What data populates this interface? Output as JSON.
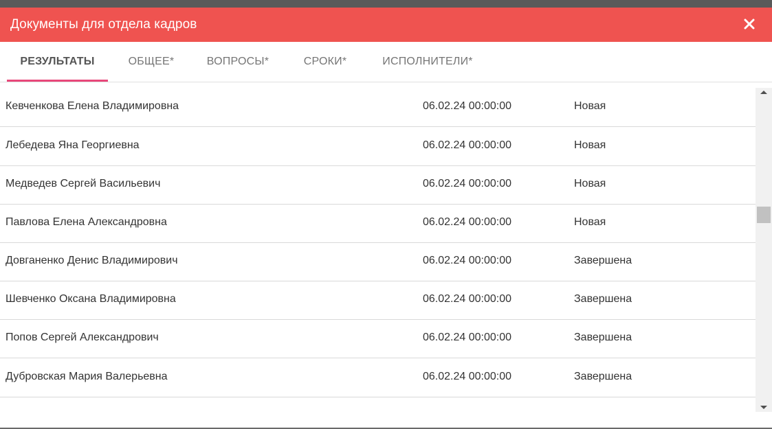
{
  "dialog": {
    "title": "Документы для отдела кадров",
    "close_icon": "close-icon",
    "accent_color": "#ef5350"
  },
  "tabs": [
    {
      "label": "РЕЗУЛЬТАТЫ",
      "active": true
    },
    {
      "label": "ОБЩЕЕ*",
      "active": false
    },
    {
      "label": "ВОПРОСЫ*",
      "active": false
    },
    {
      "label": "СРОКИ*",
      "active": false
    },
    {
      "label": "ИСПОЛНИТЕЛИ*",
      "active": false
    }
  ],
  "rows": [
    {
      "name": "Кевченкова Елена Владимировна",
      "date": "06.02.24 00:00:00",
      "status": "Новая"
    },
    {
      "name": "Лебедева Яна Георгиевна",
      "date": "06.02.24 00:00:00",
      "status": "Новая"
    },
    {
      "name": "Медведев Сергей Васильевич",
      "date": "06.02.24 00:00:00",
      "status": "Новая"
    },
    {
      "name": "Павлова Елена Александровна",
      "date": "06.02.24 00:00:00",
      "status": "Новая"
    },
    {
      "name": "Довганенко Денис Владимирович",
      "date": "06.02.24 00:00:00",
      "status": "Завершена"
    },
    {
      "name": "Шевченко Оксана Владимировна",
      "date": "06.02.24 00:00:00",
      "status": "Завершена"
    },
    {
      "name": "Попов Сергей Александрович",
      "date": "06.02.24 00:00:00",
      "status": "Завершена"
    },
    {
      "name": "Дубровская Мария Валерьевна",
      "date": "06.02.24 00:00:00",
      "status": "Завершена"
    }
  ],
  "icons": {
    "scroll_up": "triangle-up-icon",
    "scroll_down": "triangle-down-icon"
  }
}
